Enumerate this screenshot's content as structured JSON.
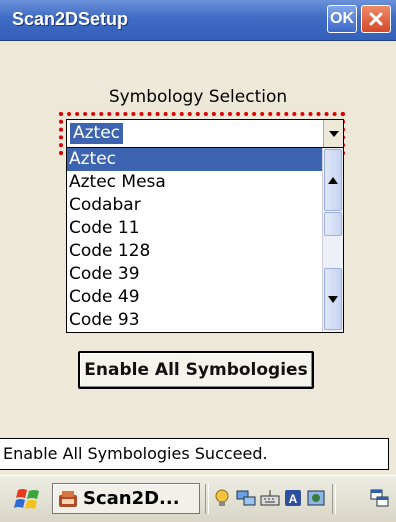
{
  "window": {
    "title": "Scan2DSetup",
    "ok_label": "OK"
  },
  "symbology": {
    "label": "Symbology Selection",
    "selected": "Aztec",
    "options": [
      "Aztec",
      "Aztec Mesa",
      "Codabar",
      "Code 11",
      "Code 128",
      "Code 39",
      "Code 49",
      "Code 93"
    ],
    "selected_index": 0
  },
  "actions": {
    "enable_all_label": "Enable All Symbologies"
  },
  "status": {
    "message": "Enable All Symbologies Succeed."
  },
  "taskbar": {
    "task_label": "Scan2D...",
    "tray_icons": [
      "bulb-icon",
      "network-icon",
      "keyboard-icon",
      "input-panel-icon",
      "device-icon"
    ],
    "extra_icon": "desktop-icon"
  },
  "colors": {
    "titlebar": "#3f6bc4",
    "selection": "#3d64b0",
    "focus_border": "#e00000",
    "background": "#ede8d8"
  }
}
